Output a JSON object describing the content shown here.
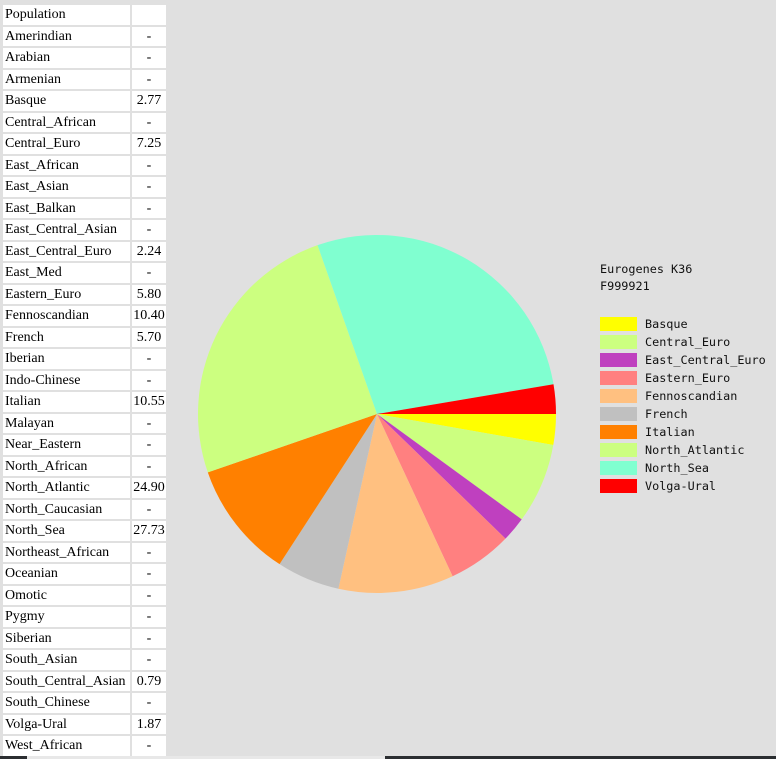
{
  "table": {
    "header": {
      "name": "Population",
      "value": ""
    },
    "rows": [
      {
        "name": "Amerindian",
        "value": "-"
      },
      {
        "name": "Arabian",
        "value": "-"
      },
      {
        "name": "Armenian",
        "value": "-"
      },
      {
        "name": "Basque",
        "value": "2.77"
      },
      {
        "name": "Central_African",
        "value": "-"
      },
      {
        "name": "Central_Euro",
        "value": "7.25"
      },
      {
        "name": "East_African",
        "value": "-"
      },
      {
        "name": "East_Asian",
        "value": "-"
      },
      {
        "name": "East_Balkan",
        "value": "-"
      },
      {
        "name": "East_Central_Asian",
        "value": "-"
      },
      {
        "name": "East_Central_Euro",
        "value": "2.24"
      },
      {
        "name": "East_Med",
        "value": "-"
      },
      {
        "name": "Eastern_Euro",
        "value": "5.80"
      },
      {
        "name": "Fennoscandian",
        "value": "10.40"
      },
      {
        "name": "French",
        "value": "5.70"
      },
      {
        "name": "Iberian",
        "value": "-"
      },
      {
        "name": "Indo-Chinese",
        "value": "-"
      },
      {
        "name": "Italian",
        "value": "10.55"
      },
      {
        "name": "Malayan",
        "value": "-"
      },
      {
        "name": "Near_Eastern",
        "value": "-"
      },
      {
        "name": "North_African",
        "value": "-"
      },
      {
        "name": "North_Atlantic",
        "value": "24.90"
      },
      {
        "name": "North_Caucasian",
        "value": "-"
      },
      {
        "name": "North_Sea",
        "value": "27.73"
      },
      {
        "name": "Northeast_African",
        "value": "-"
      },
      {
        "name": "Oceanian",
        "value": "-"
      },
      {
        "name": "Omotic",
        "value": "-"
      },
      {
        "name": "Pygmy",
        "value": "-"
      },
      {
        "name": "Siberian",
        "value": "-"
      },
      {
        "name": "South_Asian",
        "value": "-"
      },
      {
        "name": "South_Central_Asian",
        "value": "0.79"
      },
      {
        "name": "South_Chinese",
        "value": "-"
      },
      {
        "name": "Volga-Ural",
        "value": "1.87"
      },
      {
        "name": "West_African",
        "value": "-"
      }
    ]
  },
  "chart_data": {
    "type": "pie",
    "title": "Eurogenes K36",
    "subtitle": "F999921",
    "total": 100,
    "start": "east, clockwise",
    "legend_position": "right",
    "slices": [
      {
        "label": "Basque",
        "value": 2.77,
        "color": "#ffff00"
      },
      {
        "label": "Central_Euro",
        "value": 7.25,
        "color": "#ccff80"
      },
      {
        "label": "East_Central_Euro",
        "value": 2.24,
        "color": "#bf40bf"
      },
      {
        "label": "Eastern_Euro",
        "value": 5.8,
        "color": "#ff8080"
      },
      {
        "label": "Fennoscandian",
        "value": 10.4,
        "color": "#ffc080"
      },
      {
        "label": "French",
        "value": 5.7,
        "color": "#c0c0c0"
      },
      {
        "label": "Italian",
        "value": 10.55,
        "color": "#ff8000"
      },
      {
        "label": "North_Atlantic",
        "value": 24.9,
        "color": "#ccff80"
      },
      {
        "label": "North_Sea",
        "value": 27.73,
        "color": "#80ffd0"
      },
      {
        "label": "Volga-Ural",
        "value": 1.87,
        "color": "#ff0000"
      }
    ]
  }
}
